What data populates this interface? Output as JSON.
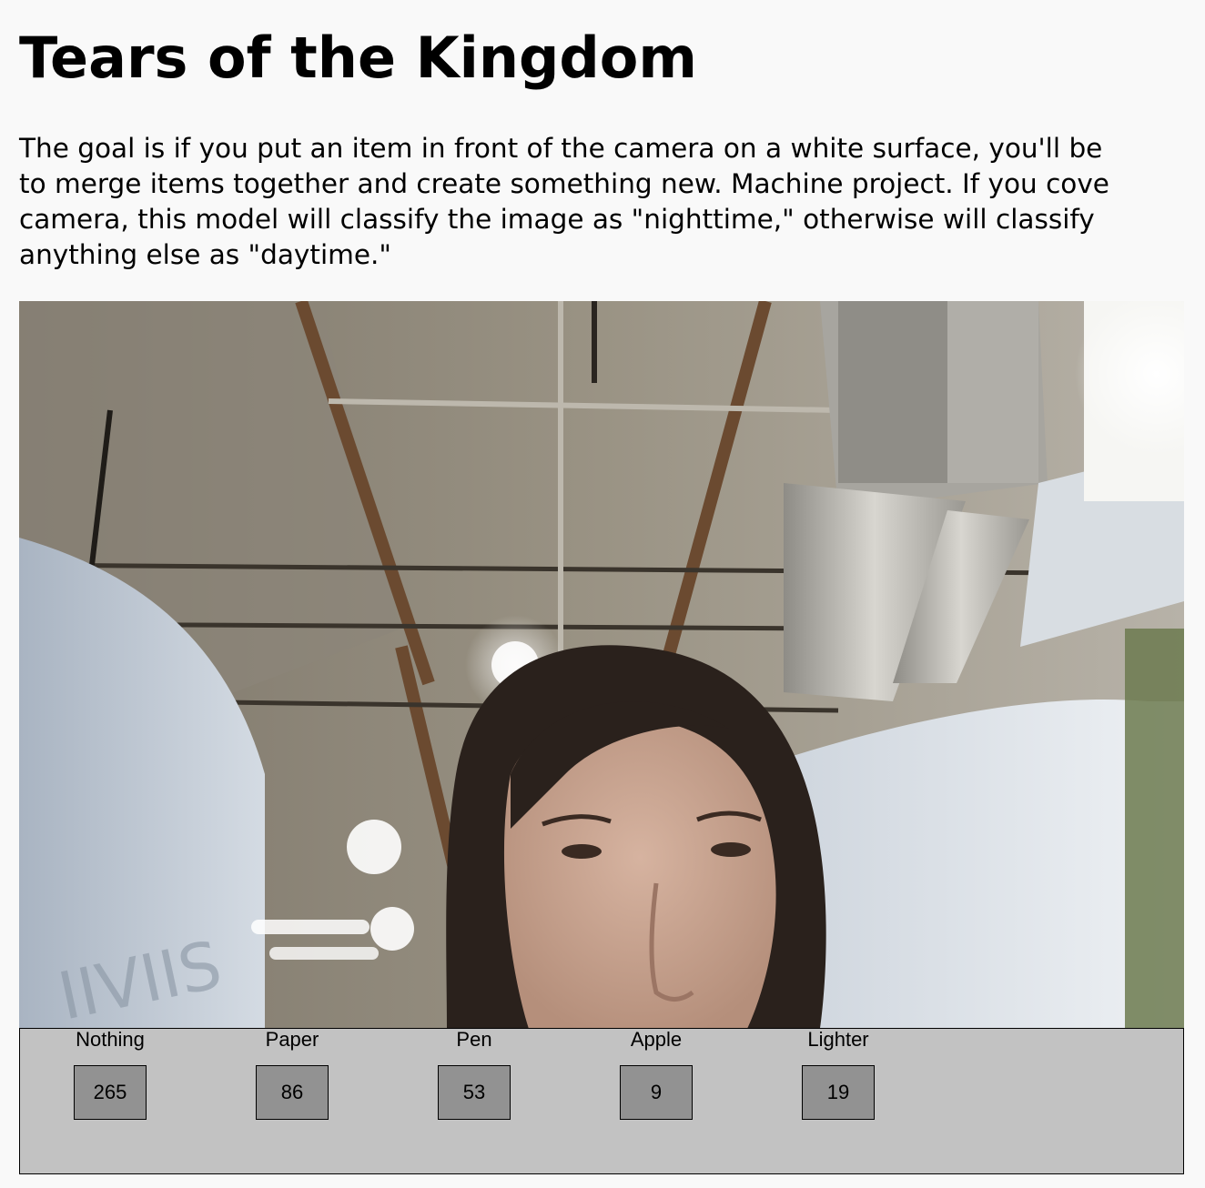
{
  "page": {
    "title": "Tears of the Kingdom",
    "description_lines": [
      "The goal is if you put an item in front of the camera on a white surface, you'll be",
      "to merge items together and create something new. Machine project. If you cove",
      "camera, this model will classify the image as \"nighttime,\" otherwise will classify",
      "anything else as \"daytime.\""
    ]
  },
  "camera": {
    "name": "webcam-feed"
  },
  "classes": [
    {
      "label": "Nothing",
      "count": "265"
    },
    {
      "label": "Paper",
      "count": "86"
    },
    {
      "label": "Pen",
      "count": "53"
    },
    {
      "label": "Apple",
      "count": "9"
    },
    {
      "label": "Lighter",
      "count": "19"
    }
  ]
}
